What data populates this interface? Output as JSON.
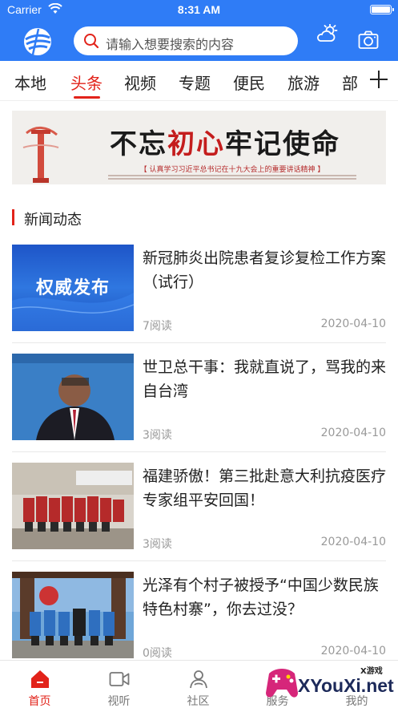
{
  "status_bar": {
    "carrier": "Carrier",
    "time": "8:31 AM"
  },
  "header": {
    "search_placeholder": "请输入想要搜索的内容",
    "icons": [
      "logo-globe",
      "search-icon",
      "weather-cloud-sun-icon",
      "camera-icon"
    ]
  },
  "tabs": {
    "items": [
      "本地",
      "头条",
      "视频",
      "专题",
      "便民",
      "旅游",
      "部"
    ],
    "active": "头条"
  },
  "banner": {
    "slogan_black1": "不忘",
    "slogan_red": "初心",
    "slogan_black2": "牢记使命",
    "subtitle": "【 认真学习习近平总书记在十九大会上的重要讲话精神 】"
  },
  "section": {
    "title": "新闻动态"
  },
  "news": [
    {
      "title": "新冠肺炎出院患者复诊复检工作方案（试行）",
      "reads": "7阅读",
      "date": "2020-04-10",
      "thumb_text": "权威发布"
    },
    {
      "title": "世卫总干事：我就直说了，骂我的来自台湾",
      "reads": "3阅读",
      "date": "2020-04-10"
    },
    {
      "title": "福建骄傲！第三批赴意大利抗疫医疗专家组平安回国！",
      "reads": "3阅读",
      "date": "2020-04-10"
    },
    {
      "title": "光泽有个村子被授予“中国少数民族特色村寨”，你去过没？",
      "reads": "0阅读",
      "date": "2020-04-10"
    }
  ],
  "bottom_nav": {
    "items": [
      "首页",
      "视听",
      "社区",
      "服务",
      "我的"
    ],
    "active": "首页"
  },
  "watermark": {
    "text": "XYouXi.net",
    "small": "X游戏"
  },
  "colors": {
    "primary": "#2f7cf6",
    "accent": "#e2231a"
  }
}
